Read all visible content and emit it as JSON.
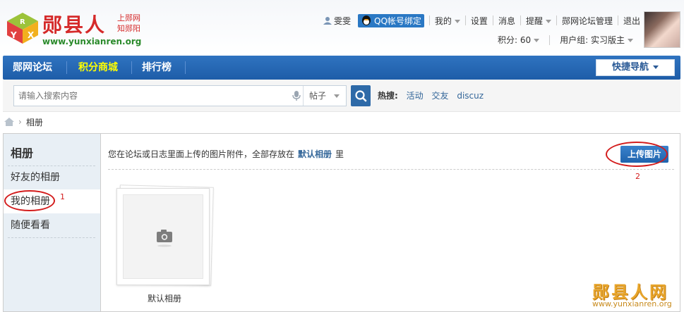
{
  "header": {
    "logo_title": "郧县人",
    "logo_sub_1": "上郧网",
    "logo_sub_2": "知郧阳",
    "logo_url": "www.yunxianren.org",
    "logo_cube_letters": [
      "R",
      "Y",
      "X"
    ]
  },
  "userbar": {
    "username": "雯雯",
    "qq_bind": "QQ帐号绑定",
    "my": "我的",
    "settings": "设置",
    "messages": "消息",
    "remind": "提醒",
    "forum_admin": "郧网论坛管理",
    "logout": "退出",
    "points": "积分: 60",
    "user_group": "用户组: 实习版主"
  },
  "nav": {
    "items": [
      "郧网论坛",
      "积分商城",
      "排行榜"
    ],
    "quick_nav": "快捷导航"
  },
  "search": {
    "placeholder": "请输入搜索内容",
    "type": "帖子",
    "hot_label": "热搜:",
    "hot_items": [
      "活动",
      "交友",
      "discuz"
    ]
  },
  "breadcrumb": {
    "current": "相册"
  },
  "sidebar": {
    "title": "相册",
    "items": [
      "好友的相册",
      "我的相册",
      "随便看看"
    ],
    "active_index": 1
  },
  "main": {
    "info_prefix": "您在论坛或日志里面上传的图片附件，全部存放在",
    "info_link": "默认相册",
    "info_suffix": "里",
    "upload_button": "上传图片",
    "album_name": "默认相册"
  },
  "annotations": {
    "mark_1": "1",
    "mark_2": "2"
  },
  "watermark": {
    "title": "郧县人网",
    "url": "www.yunxianren.org"
  },
  "colors": {
    "nav_blue": "#1e5da8",
    "nav_highlight": "#ffff00",
    "accent_red": "#d31c1c",
    "link_blue": "#336699"
  }
}
